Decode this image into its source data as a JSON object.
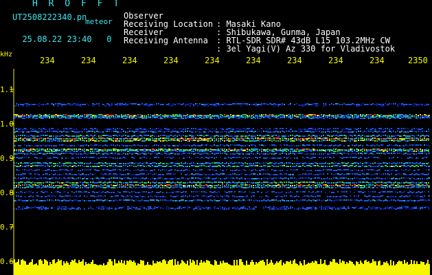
{
  "header": {
    "title": "H R O F F T",
    "filename": "UT2508222340.pn",
    "meteor_label": "meteor",
    "date": "25.08.22 23:40",
    "count": "0",
    "fields": [
      {
        "label": "Observer",
        "value": ": Masaki Kano"
      },
      {
        "label": "Receiving Location",
        "value": ": Shibukawa, Gunma, Japan"
      },
      {
        "label": "Receiver",
        "value": ": RTL-SDR SDR# 43dB L15 103.2MHz CW"
      },
      {
        "label": "Receiving Antenna",
        "value": ": 3el Yagi(V) Az 330 for Vladivostok"
      }
    ]
  },
  "axes": {
    "y_unit": "kHz",
    "y_ticks": [
      "1.1",
      "1.0",
      "0.9",
      "0.8",
      "0.7",
      "0.6"
    ],
    "x_ticks": [
      "234",
      "234",
      "234",
      "234",
      "234",
      "234",
      "234",
      "234",
      "234",
      "2350"
    ]
  },
  "colors": {
    "background": "#000000",
    "header_cyan": "#37e9ee",
    "axis_yellow": "#f6f600",
    "spectrum_blue": "#1020d0"
  }
}
